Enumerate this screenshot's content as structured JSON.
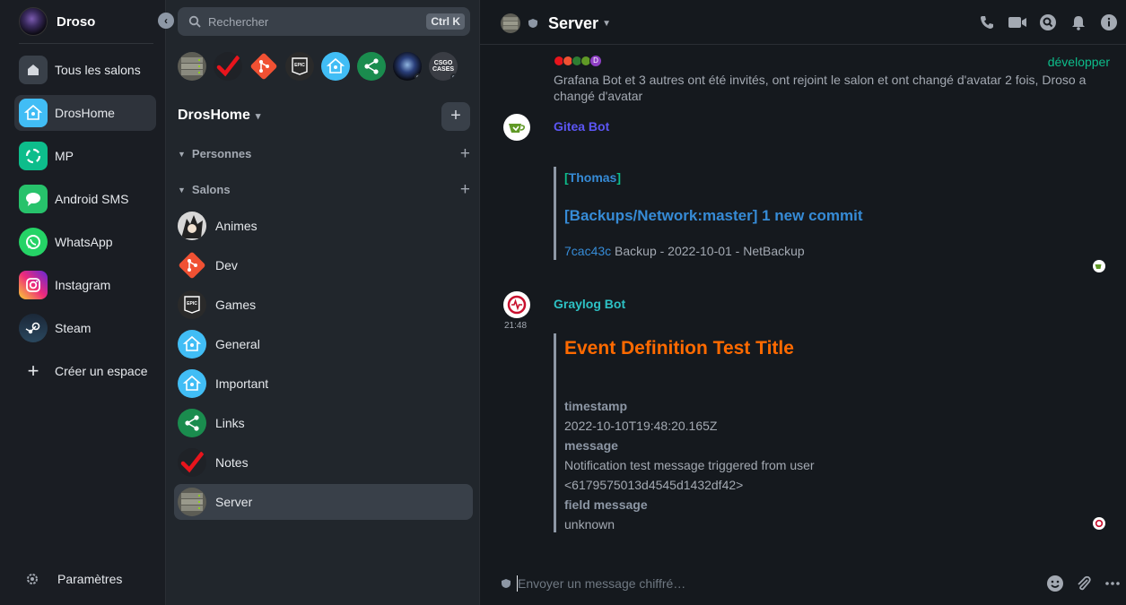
{
  "user": {
    "name": "Droso"
  },
  "spaces": [
    {
      "label": "Tous les salons",
      "icon": "home-icon"
    },
    {
      "label": "DrosHome",
      "icon": "droshome-icon",
      "active": true
    },
    {
      "label": "MP",
      "icon": "element-icon"
    },
    {
      "label": "Android SMS",
      "icon": "sms-icon"
    },
    {
      "label": "WhatsApp",
      "icon": "whatsapp-icon"
    },
    {
      "label": "Instagram",
      "icon": "instagram-icon"
    },
    {
      "label": "Steam",
      "icon": "steam-icon"
    },
    {
      "label": "Créer un espace",
      "icon": "plus-icon"
    }
  ],
  "settings_label": "Paramètres",
  "search": {
    "placeholder": "Rechercher",
    "shortcut": "Ctrl K"
  },
  "recent_bubbles": [
    "server",
    "notes",
    "dev",
    "games",
    "general",
    "links",
    "droso",
    "csgo"
  ],
  "csgo_text": "CSGO CASES",
  "space_name": "DrosHome",
  "sections": {
    "people": "Personnes",
    "rooms": "Salons"
  },
  "rooms": [
    {
      "label": "Animes"
    },
    {
      "label": "Dev"
    },
    {
      "label": "Games"
    },
    {
      "label": "General"
    },
    {
      "label": "Important"
    },
    {
      "label": "Links"
    },
    {
      "label": "Notes"
    },
    {
      "label": "Server",
      "active": true
    }
  ],
  "header": {
    "room_name": "Server"
  },
  "summary": {
    "expand_label": "développer",
    "text": "Grafana Bot et 3 autres ont été invités, ont rejoint le salon et ont changé d'avatar 2 fois, Droso a changé d'avatar",
    "avatar_letter": "D"
  },
  "gitea": {
    "sender": "Gitea Bot",
    "bracket_open": "[",
    "user": "Thomas",
    "bracket_close": "]",
    "title": "[Backups/Network:master] 1 new commit",
    "commit_hash": "7cac43c",
    "commit_msg": " Backup - 2022-10-01 - NetBackup"
  },
  "graylog": {
    "sender": "Graylog Bot",
    "time": "21:48",
    "title": "Event Definition Test Title",
    "timestamp_label": "timestamp",
    "timestamp_value": "2022-10-10T19:48:20.165Z",
    "message_label": "message",
    "message_value_1": "Notification test message triggered from user",
    "message_value_2": "<6179575013d4545d1432df42>",
    "field_label": "field message",
    "field_value": "unknown"
  },
  "composer": {
    "placeholder": "Envoyer un message chiffré…"
  },
  "colors": {
    "accent_green": "#0dbd8b",
    "gitea_name": "#5c56f5",
    "graylog_name": "#2dc2c5",
    "link_blue": "#368bd6",
    "event_orange": "#ff6a00"
  }
}
